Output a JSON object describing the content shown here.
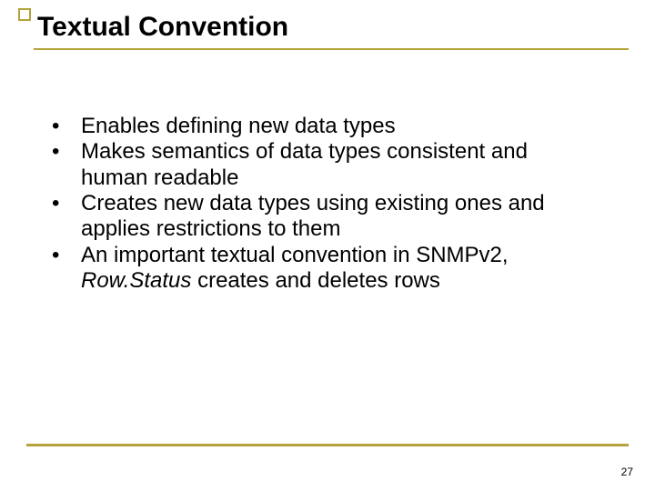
{
  "slide": {
    "title": "Textual Convention",
    "bullets": [
      {
        "mark": "•",
        "text": "Enables defining new data types"
      },
      {
        "mark": "•",
        "text": "Makes semantics of data types consistent and human readable"
      },
      {
        "mark": "•",
        "text": "Creates new data types using existing ones and applies restrictions to them"
      },
      {
        "mark": "•",
        "text_pre": "An important textual convention in SNMPv2, ",
        "italic": "Row.Status",
        "text_post": " creates and deletes rows"
      }
    ],
    "page_number": "27"
  }
}
